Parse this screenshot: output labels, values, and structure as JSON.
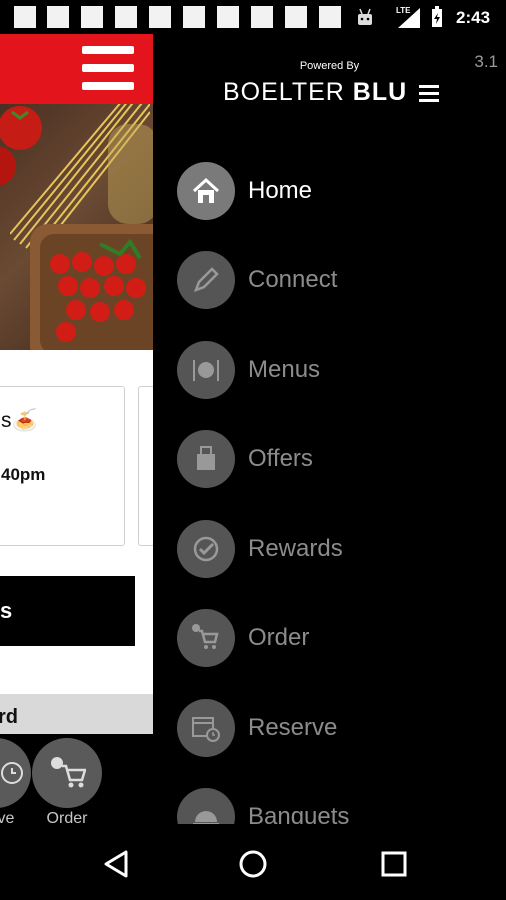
{
  "status_bar": {
    "time": "2:43",
    "network": "LTE"
  },
  "app": {
    "card_title": "s🍝",
    "card_hours": "40pm",
    "black_button_label": "s",
    "grey_band_label": "rd",
    "bottom_nav": [
      {
        "label": "ve",
        "icon": "reserve-icon"
      },
      {
        "label": "Order",
        "icon": "cart-icon"
      }
    ],
    "colors": {
      "header": "#e3141b"
    }
  },
  "drawer": {
    "version": "3.1",
    "powered_by": "Powered By",
    "brand_left": "BOELTER",
    "brand_right": "BLU",
    "items": [
      {
        "label": "Home",
        "icon": "home-icon",
        "active": true
      },
      {
        "label": "Connect",
        "icon": "pencil-icon",
        "active": false
      },
      {
        "label": "Menus",
        "icon": "plate-icon",
        "active": false
      },
      {
        "label": "Offers",
        "icon": "offer-tag-icon",
        "active": false
      },
      {
        "label": "Rewards",
        "icon": "check-badge-icon",
        "active": false
      },
      {
        "label": "Order",
        "icon": "cart-icon",
        "active": false
      },
      {
        "label": "Reserve",
        "icon": "calendar-icon",
        "active": false
      },
      {
        "label": "Banquets",
        "icon": "cloche-icon",
        "active": false
      }
    ]
  },
  "system_nav": {
    "back": "back-icon",
    "home": "home-circle-icon",
    "recents": "recents-icon"
  }
}
